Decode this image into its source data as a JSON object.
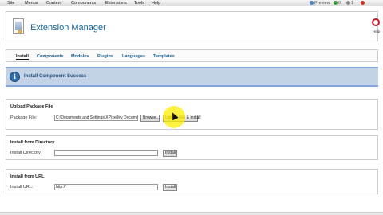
{
  "menubar": {
    "items": [
      "Site",
      "Menus",
      "Content",
      "Components",
      "Extensions",
      "Tools",
      "Help"
    ],
    "right": {
      "preview": "Preview",
      "count1": "0",
      "count2": "1"
    }
  },
  "header": {
    "title": "Extension Manager",
    "help_label": "Help"
  },
  "tabs": [
    "Install",
    "Components",
    "Modules",
    "Plugins",
    "Languages",
    "Templates"
  ],
  "active_tab": "Install",
  "message": {
    "text": "Install Component Success"
  },
  "upload": {
    "title": "Upload Package File",
    "label": "Package File:",
    "value": "C:\\Documents and Settings\\XP\\xe\\My Documents\\",
    "browse_label": "Browse...",
    "upload_label": "Upload File & Install"
  },
  "directory": {
    "title": "Install from Directory",
    "label": "Install Directory:",
    "value": "",
    "button_label": "Install"
  },
  "url": {
    "title": "Install from URL",
    "label": "Install URL:",
    "value": "http://",
    "button_label": "Install"
  }
}
